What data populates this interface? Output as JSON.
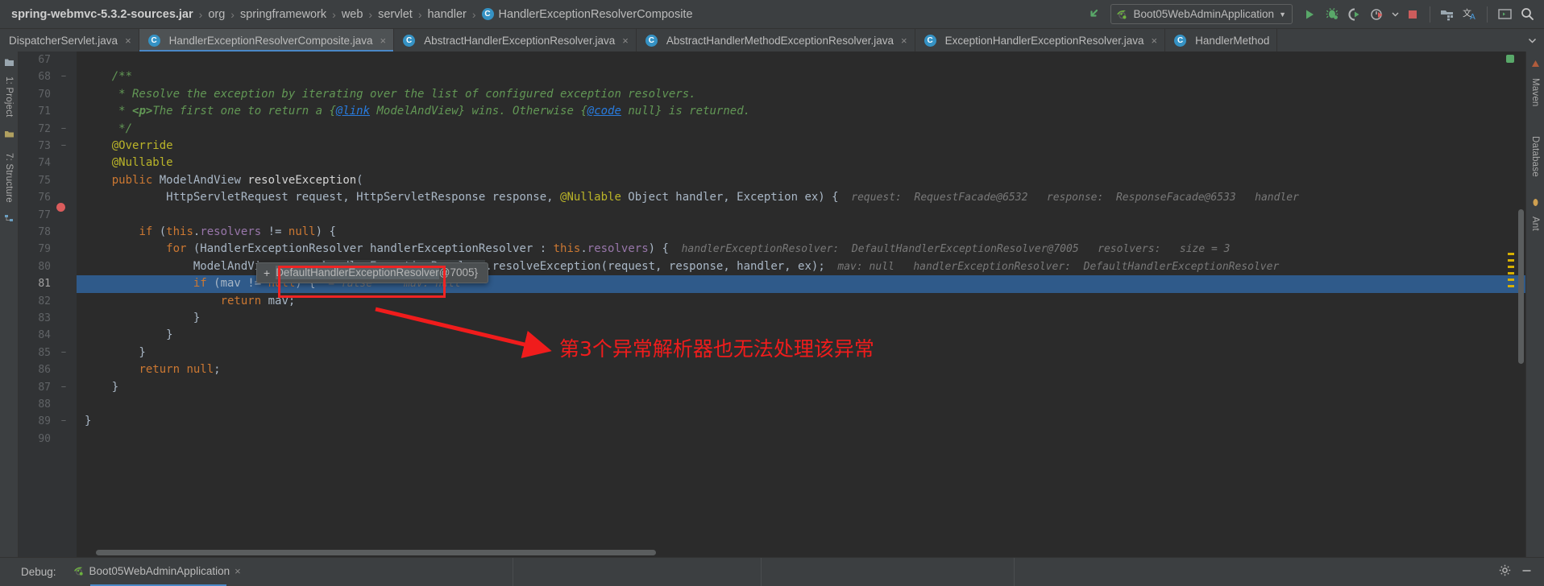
{
  "breadcrumb": {
    "items": [
      {
        "label": "spring-webmvc-5.3.2-sources.jar",
        "bold": true,
        "icon": null
      },
      {
        "label": "org",
        "bold": false,
        "icon": null
      },
      {
        "label": "springframework",
        "bold": false,
        "icon": null
      },
      {
        "label": "web",
        "bold": false,
        "icon": null
      },
      {
        "label": "servlet",
        "bold": false,
        "icon": null
      },
      {
        "label": "handler",
        "bold": false,
        "icon": null
      },
      {
        "label": "HandlerExceptionResolverComposite",
        "bold": false,
        "icon": "class-badge"
      }
    ],
    "separator": "›"
  },
  "toolbar": {
    "back_icon": "back-arrow-icon",
    "run_config": {
      "label": "Boot05WebAdminApplication",
      "icon": "spring-boot-icon",
      "chevron": "▼"
    },
    "actions": [
      {
        "name": "run-button",
        "icon": "run-icon"
      },
      {
        "name": "debug-button",
        "icon": "debug-bug-icon"
      },
      {
        "name": "run-coverage-button",
        "icon": "coverage-icon"
      },
      {
        "name": "profiler-button",
        "icon": "profiler-icon"
      },
      {
        "name": "profiler-dropdown",
        "icon": "chevron-down-icon"
      },
      {
        "name": "stop-button",
        "icon": "stop-square-icon"
      },
      {
        "name": "project-structure-button",
        "icon": "project-structure-icon"
      },
      {
        "name": "translate-button",
        "icon": "translate-icon"
      },
      {
        "name": "terminal-button",
        "icon": "terminal-icon"
      },
      {
        "name": "search-everywhere-button",
        "icon": "search-icon"
      }
    ]
  },
  "tabs": [
    {
      "label": "DispatcherServlet.java",
      "active": false,
      "icon": false,
      "close": "×"
    },
    {
      "label": "HandlerExceptionResolverComposite.java",
      "active": true,
      "icon": true,
      "close": "×"
    },
    {
      "label": "AbstractHandlerExceptionResolver.java",
      "active": false,
      "icon": true,
      "close": "×"
    },
    {
      "label": "AbstractHandlerMethodExceptionResolver.java",
      "active": false,
      "icon": true,
      "close": "×"
    },
    {
      "label": "ExceptionHandlerExceptionResolver.java",
      "active": false,
      "icon": true,
      "close": "×"
    },
    {
      "label": "HandlerMethod",
      "active": false,
      "icon": true,
      "close": ""
    }
  ],
  "tabs_overflow_icon": "chevron-down-icon",
  "left_strip": {
    "items": [
      {
        "label": "1: Project",
        "name": "tool-window-project"
      },
      {
        "label": "7: Structure",
        "name": "tool-window-structure"
      }
    ]
  },
  "right_strip": {
    "items": [
      {
        "label": "Maven",
        "name": "tool-window-maven"
      },
      {
        "label": "Database",
        "name": "tool-window-database"
      },
      {
        "label": "Ant",
        "name": "tool-window-ant"
      }
    ]
  },
  "editor": {
    "first_line": 67,
    "current_line": 81,
    "lines": [
      {
        "n": 67,
        "fold": "",
        "segs": [
          {
            "t": "    ",
            "c": "c-txt"
          }
        ]
      },
      {
        "n": 68,
        "fold": "−",
        "segs": [
          {
            "t": "    /**",
            "c": "c-cmt"
          }
        ]
      },
      {
        "n": 70,
        "fold": "",
        "segs": [
          {
            "t": "     * Resolve the exception by iterating over the list of configured exception resolvers.",
            "c": "c-cmt"
          }
        ]
      },
      {
        "n": 71,
        "fold": "",
        "segs": [
          {
            "t": "     * ",
            "c": "c-cmt"
          },
          {
            "t": "<p>",
            "c": "c-cmtb"
          },
          {
            "t": "The first one to return a {",
            "c": "c-cmt"
          },
          {
            "t": "@link",
            "c": "c-link"
          },
          {
            "t": " ModelAndView} wins. Otherwise {",
            "c": "c-cmt"
          },
          {
            "t": "@code",
            "c": "c-link"
          },
          {
            "t": " null} is returned.",
            "c": "c-cmt"
          }
        ]
      },
      {
        "n": 72,
        "fold": "−",
        "segs": [
          {
            "t": "     */",
            "c": "c-cmt"
          }
        ]
      },
      {
        "n": 73,
        "fold": "−",
        "segs": [
          {
            "t": "    @Override",
            "c": "c-ann"
          }
        ]
      },
      {
        "n": 74,
        "fold": "",
        "segs": [
          {
            "t": "    @Nullable",
            "c": "c-ann"
          }
        ]
      },
      {
        "n": 75,
        "fold": "",
        "segs": [
          {
            "t": "    ",
            "c": "c-txt"
          },
          {
            "t": "public",
            "c": "c-kw"
          },
          {
            "t": " ModelAndView ",
            "c": "c-txt"
          },
          {
            "t": "resolveException",
            "c": "c-white"
          },
          {
            "t": "(",
            "c": "c-txt"
          }
        ]
      },
      {
        "n": 76,
        "fold": "",
        "segs": [
          {
            "t": "            HttpServletRequest request, HttpServletResponse response, ",
            "c": "c-txt"
          },
          {
            "t": "@Nullable",
            "c": "c-ann"
          },
          {
            "t": " Object handler, Exception ex) {",
            "c": "c-txt"
          }
        ],
        "hints": "  request:  RequestFacade@6532   response:  ResponseFacade@6533   handler"
      },
      {
        "n": 77,
        "fold": "",
        "segs": [
          {
            "t": "",
            "c": "c-txt"
          }
        ]
      },
      {
        "n": 78,
        "fold": "",
        "segs": [
          {
            "t": "        ",
            "c": "c-txt"
          },
          {
            "t": "if",
            "c": "c-kw"
          },
          {
            "t": " (",
            "c": "c-txt"
          },
          {
            "t": "this",
            "c": "c-kw"
          },
          {
            "t": ".",
            "c": "c-txt"
          },
          {
            "t": "resolvers",
            "c": "c-fld"
          },
          {
            "t": " != ",
            "c": "c-txt"
          },
          {
            "t": "null",
            "c": "c-kw"
          },
          {
            "t": ") {",
            "c": "c-txt"
          }
        ]
      },
      {
        "n": 79,
        "fold": "",
        "segs": [
          {
            "t": "            ",
            "c": "c-txt"
          },
          {
            "t": "for",
            "c": "c-kw"
          },
          {
            "t": " (HandlerExceptionResolver handlerExceptionResolver : ",
            "c": "c-txt"
          },
          {
            "t": "this",
            "c": "c-kw"
          },
          {
            "t": ".",
            "c": "c-txt"
          },
          {
            "t": "resolvers",
            "c": "c-fld"
          },
          {
            "t": ") {",
            "c": "c-txt"
          }
        ],
        "hints": "  handlerExceptionResolver:  DefaultHandlerExceptionResolver@7005   resolvers:   size = 3"
      },
      {
        "n": 80,
        "fold": "",
        "segs": [
          {
            "t": "                ModelAndView mav = ",
            "c": "c-txt"
          },
          {
            "t": "handlerExceptionResolver",
            "c": "c-sel"
          },
          {
            "t": ".resolveException(request, response, handler, ex);",
            "c": "c-txt"
          }
        ],
        "hints": "  mav: null   handlerExceptionResolver:  DefaultHandlerExceptionResolver"
      },
      {
        "n": 81,
        "fold": "",
        "current": true,
        "segs": [
          {
            "t": "                ",
            "c": "c-txt"
          },
          {
            "t": "if",
            "c": "c-kw"
          },
          {
            "t": " (mav != ",
            "c": "c-txt"
          },
          {
            "t": "null",
            "c": "c-kw"
          },
          {
            "t": ") {",
            "c": "c-txt"
          }
        ],
        "hints": "  = false     mav: null"
      },
      {
        "n": 82,
        "fold": "",
        "segs": [
          {
            "t": "                    ",
            "c": "c-txt"
          },
          {
            "t": "return",
            "c": "c-kw"
          },
          {
            "t": " mav;",
            "c": "c-txt"
          }
        ]
      },
      {
        "n": 83,
        "fold": "",
        "segs": [
          {
            "t": "                }",
            "c": "c-txt"
          }
        ]
      },
      {
        "n": 84,
        "fold": "",
        "segs": [
          {
            "t": "            }",
            "c": "c-txt"
          }
        ]
      },
      {
        "n": 85,
        "fold": "−",
        "segs": [
          {
            "t": "        }",
            "c": "c-txt"
          }
        ]
      },
      {
        "n": 86,
        "fold": "",
        "segs": [
          {
            "t": "        ",
            "c": "c-txt"
          },
          {
            "t": "return",
            "c": "c-kw"
          },
          {
            "t": " ",
            "c": "c-txt"
          },
          {
            "t": "null",
            "c": "c-kw"
          },
          {
            "t": ";",
            "c": "c-txt"
          }
        ]
      },
      {
        "n": 87,
        "fold": "−",
        "segs": [
          {
            "t": "    }",
            "c": "c-txt"
          }
        ]
      },
      {
        "n": 88,
        "fold": "",
        "segs": [
          {
            "t": "",
            "c": "c-txt"
          }
        ]
      },
      {
        "n": 89,
        "fold": "−",
        "segs": [
          {
            "t": "}",
            "c": "c-txt"
          }
        ]
      },
      {
        "n": 90,
        "fold": "",
        "segs": [
          {
            "t": "",
            "c": "c-txt"
          }
        ]
      }
    ]
  },
  "tooltip": {
    "plus": "+",
    "selected_text": "DefaultHandlerExceptionResolver",
    "suffix": "@7005}"
  },
  "annotation": {
    "text": "第3个异常解析器也无法处理该异常",
    "color": "#f01c1c",
    "arrow": "red-arrow",
    "box": "red-highlight-box"
  },
  "bottombar": {
    "debug_label": "Debug:",
    "session_tab": "Boot05WebAdminApplication",
    "session_icon": "spring-boot-icon",
    "close": "×",
    "settings_icon": "gear-icon",
    "minimize_icon": "minimize-icon",
    "help_icon": "help-icon"
  },
  "colors": {
    "accent": "#4a88c7",
    "annotation_red": "#f01c1c",
    "editor_bg": "#2b2b2b",
    "chrome_bg": "#3c3f41",
    "highlight_line": "#2f5a8a"
  }
}
